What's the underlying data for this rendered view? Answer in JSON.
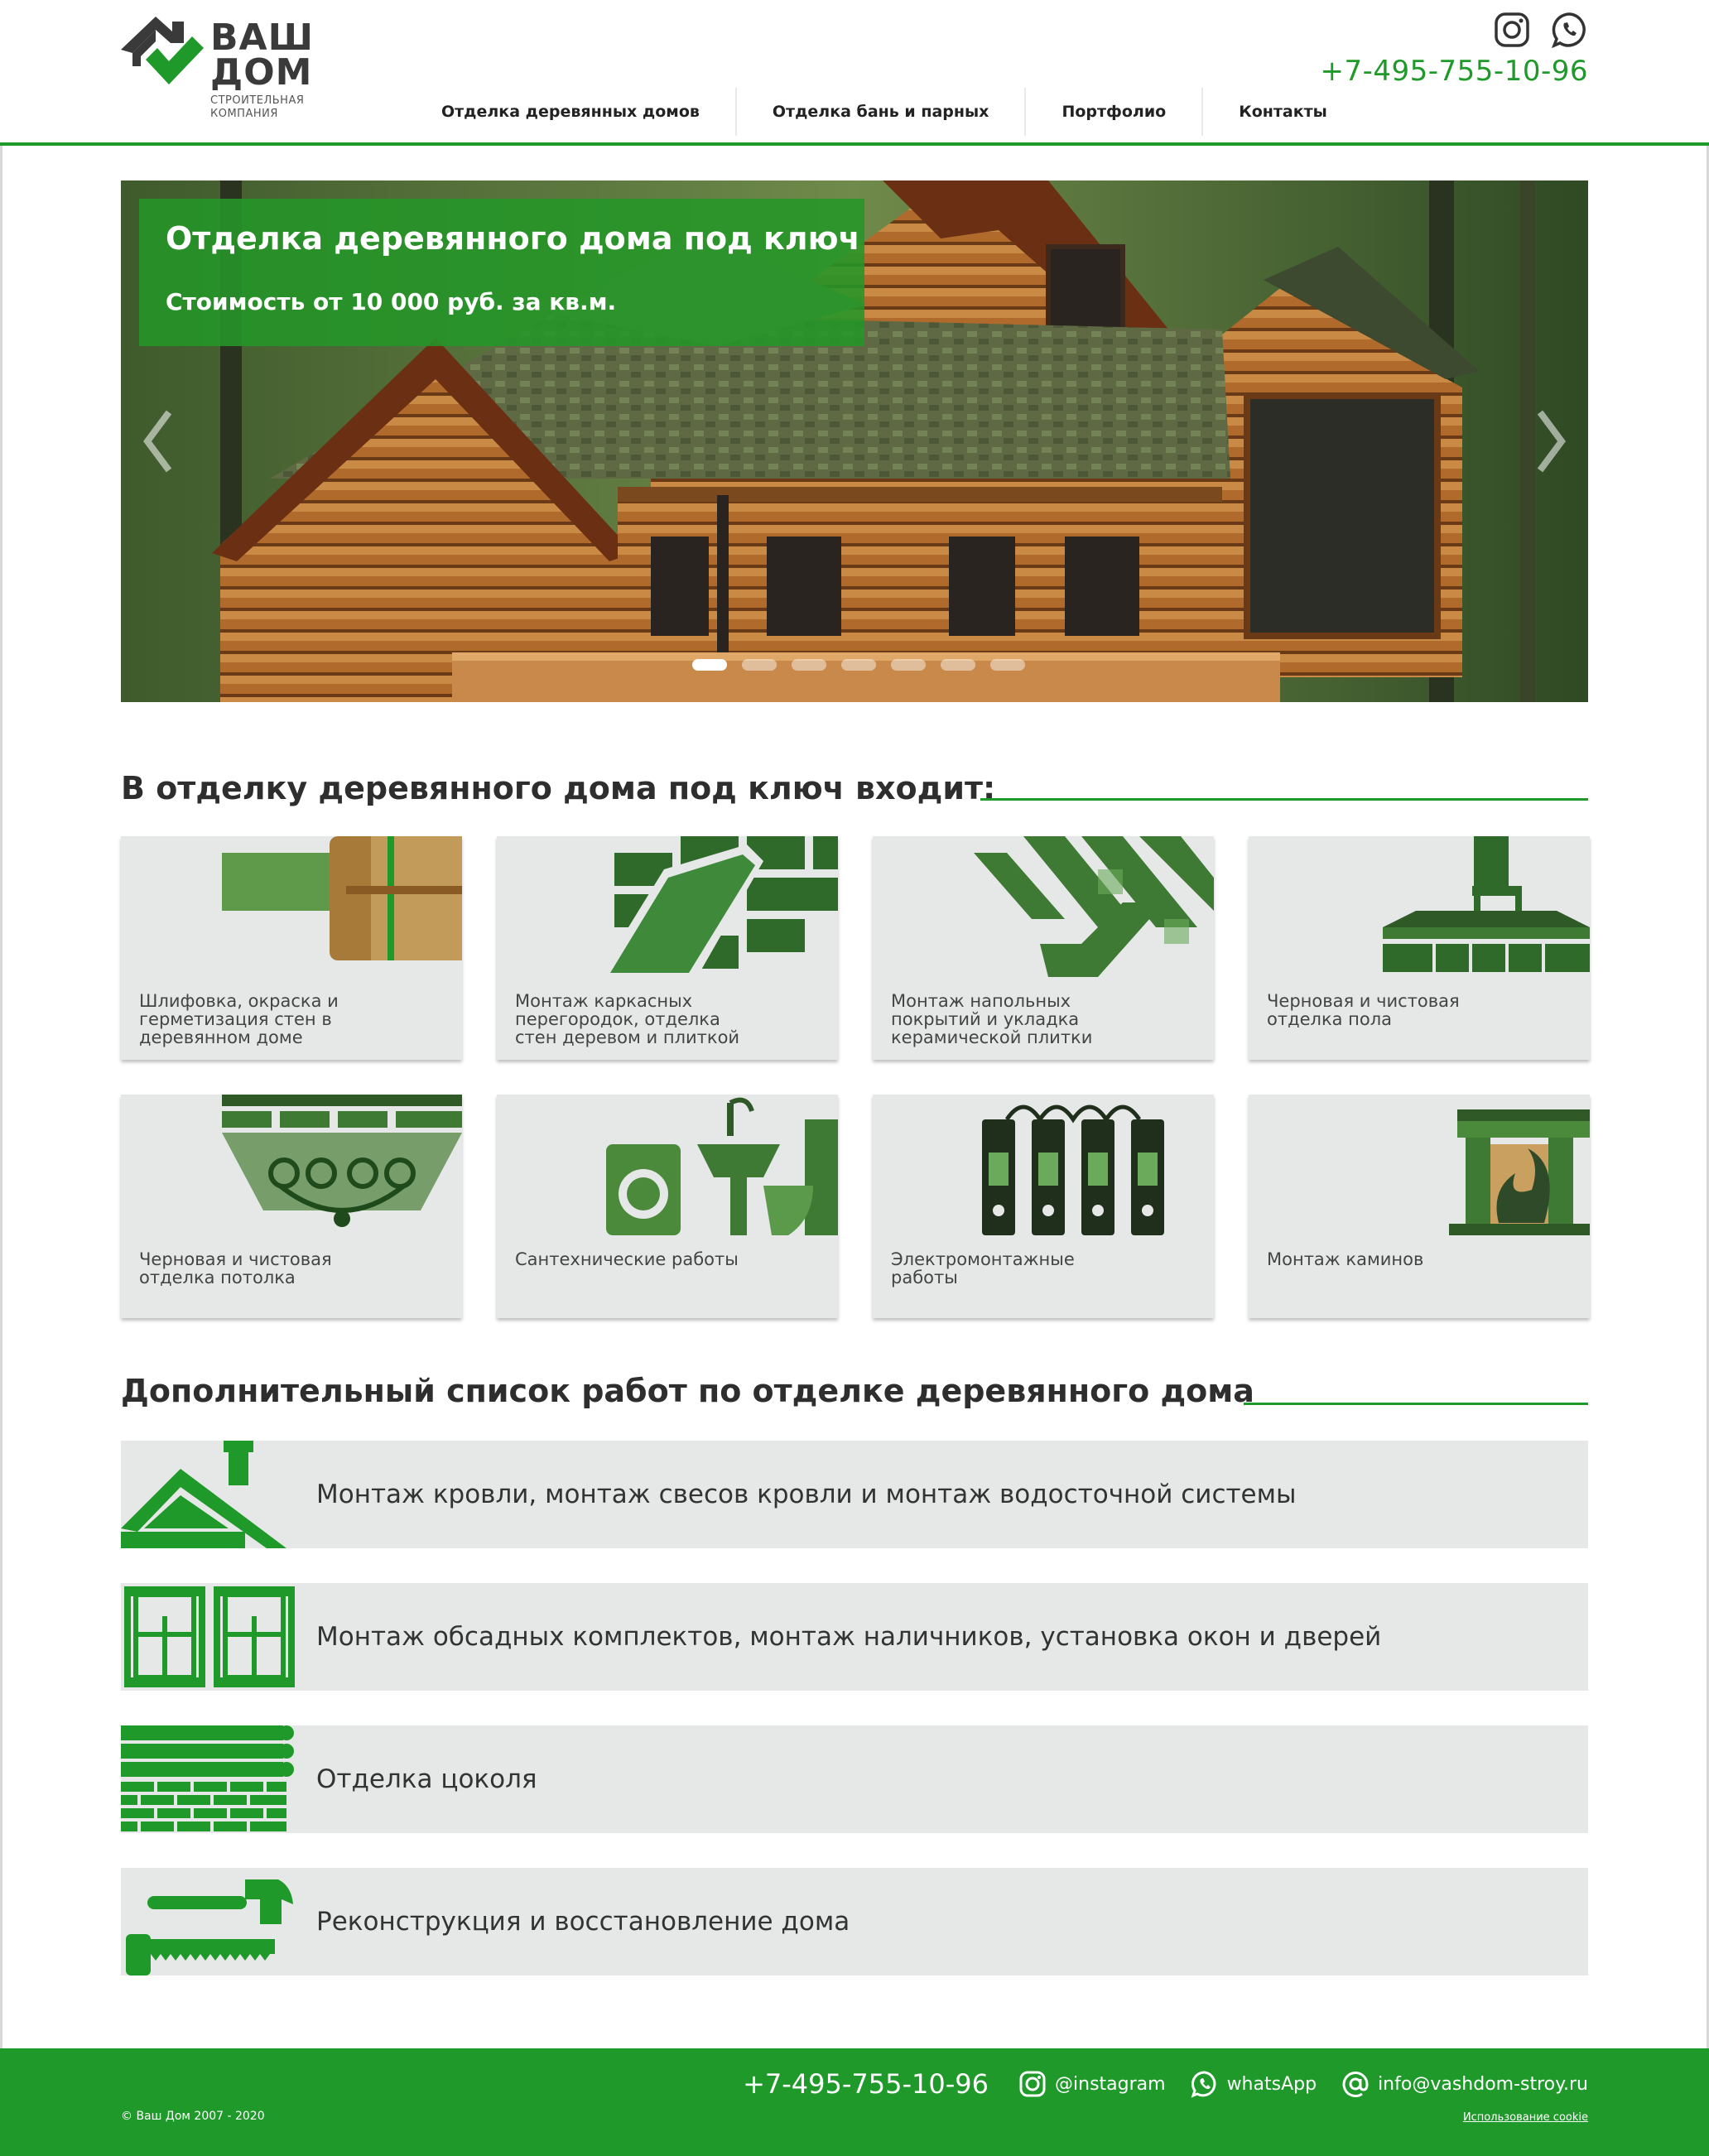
{
  "logo": {
    "line1": "ВАШ",
    "line2": "ДОМ",
    "sub1": "СТРОИТЕЛЬНАЯ",
    "sub2": "КОМПАНИЯ"
  },
  "nav": {
    "items": [
      {
        "label": "Отделка деревянных домов"
      },
      {
        "label": "Отделка бань и парных"
      },
      {
        "label": "Портфолио"
      },
      {
        "label": "Контакты"
      }
    ]
  },
  "header": {
    "phone": "+7-495-755-10-96",
    "icons": [
      "instagram-icon",
      "whatsapp-icon"
    ]
  },
  "hero": {
    "title": "Отделка деревянного дома под ключ",
    "subtitle": "Стоимость от 10 000 руб. за кв.м.",
    "slide_count": 7,
    "active_slide": 1
  },
  "included": {
    "title": "В отделку деревянного дома под ключ входит:",
    "cards": [
      {
        "label": "Шлифовка, окраска и герметизация стен в деревянном доме",
        "icon": "log-wall-icon"
      },
      {
        "label": "Монтаж каркасных перегородок, отделка стен деревом и плиткой",
        "icon": "trowel-tile-icon"
      },
      {
        "label": "Монтаж напольных покрытий и укладка керамической плитки",
        "icon": "parquet-icon"
      },
      {
        "label": "Черновая и чистовая отделка пола",
        "icon": "chair-floor-icon"
      },
      {
        "label": "Черновая и чистовая отделка потолка",
        "icon": "chandelier-icon"
      },
      {
        "label": "Сантехнические работы",
        "icon": "plumbing-icon"
      },
      {
        "label": "Электромонтажные работы",
        "icon": "sockets-icon"
      },
      {
        "label": "Монтаж каминов",
        "icon": "fireplace-icon"
      }
    ]
  },
  "extra": {
    "title": "Дополнительный список работ по отделке деревянного дома",
    "items": [
      {
        "label": "Монтаж кровли, монтаж свесов кровли и монтаж водосточной системы",
        "icon": "roof-icon"
      },
      {
        "label": "Монтаж обсадных комплектов, монтаж наличников, установка окон и дверей",
        "icon": "windows-icon"
      },
      {
        "label": "Отделка цоколя",
        "icon": "plinth-icon"
      },
      {
        "label": "Реконструкция и восстановление дома",
        "icon": "hammer-saw-icon"
      }
    ]
  },
  "footer": {
    "phone": "+7-495-755-10-96",
    "instagram": "@instagram",
    "whatsapp": "whatsApp",
    "email": "info@vashdom-stroy.ru",
    "copyright": "© Ваш Дом 2007 - 2020",
    "cookie": "Использование cookie"
  },
  "colors": {
    "brand_green": "#1f9a2a",
    "card_bg": "#e6e8e8",
    "text_dark": "#2e2e2e"
  }
}
